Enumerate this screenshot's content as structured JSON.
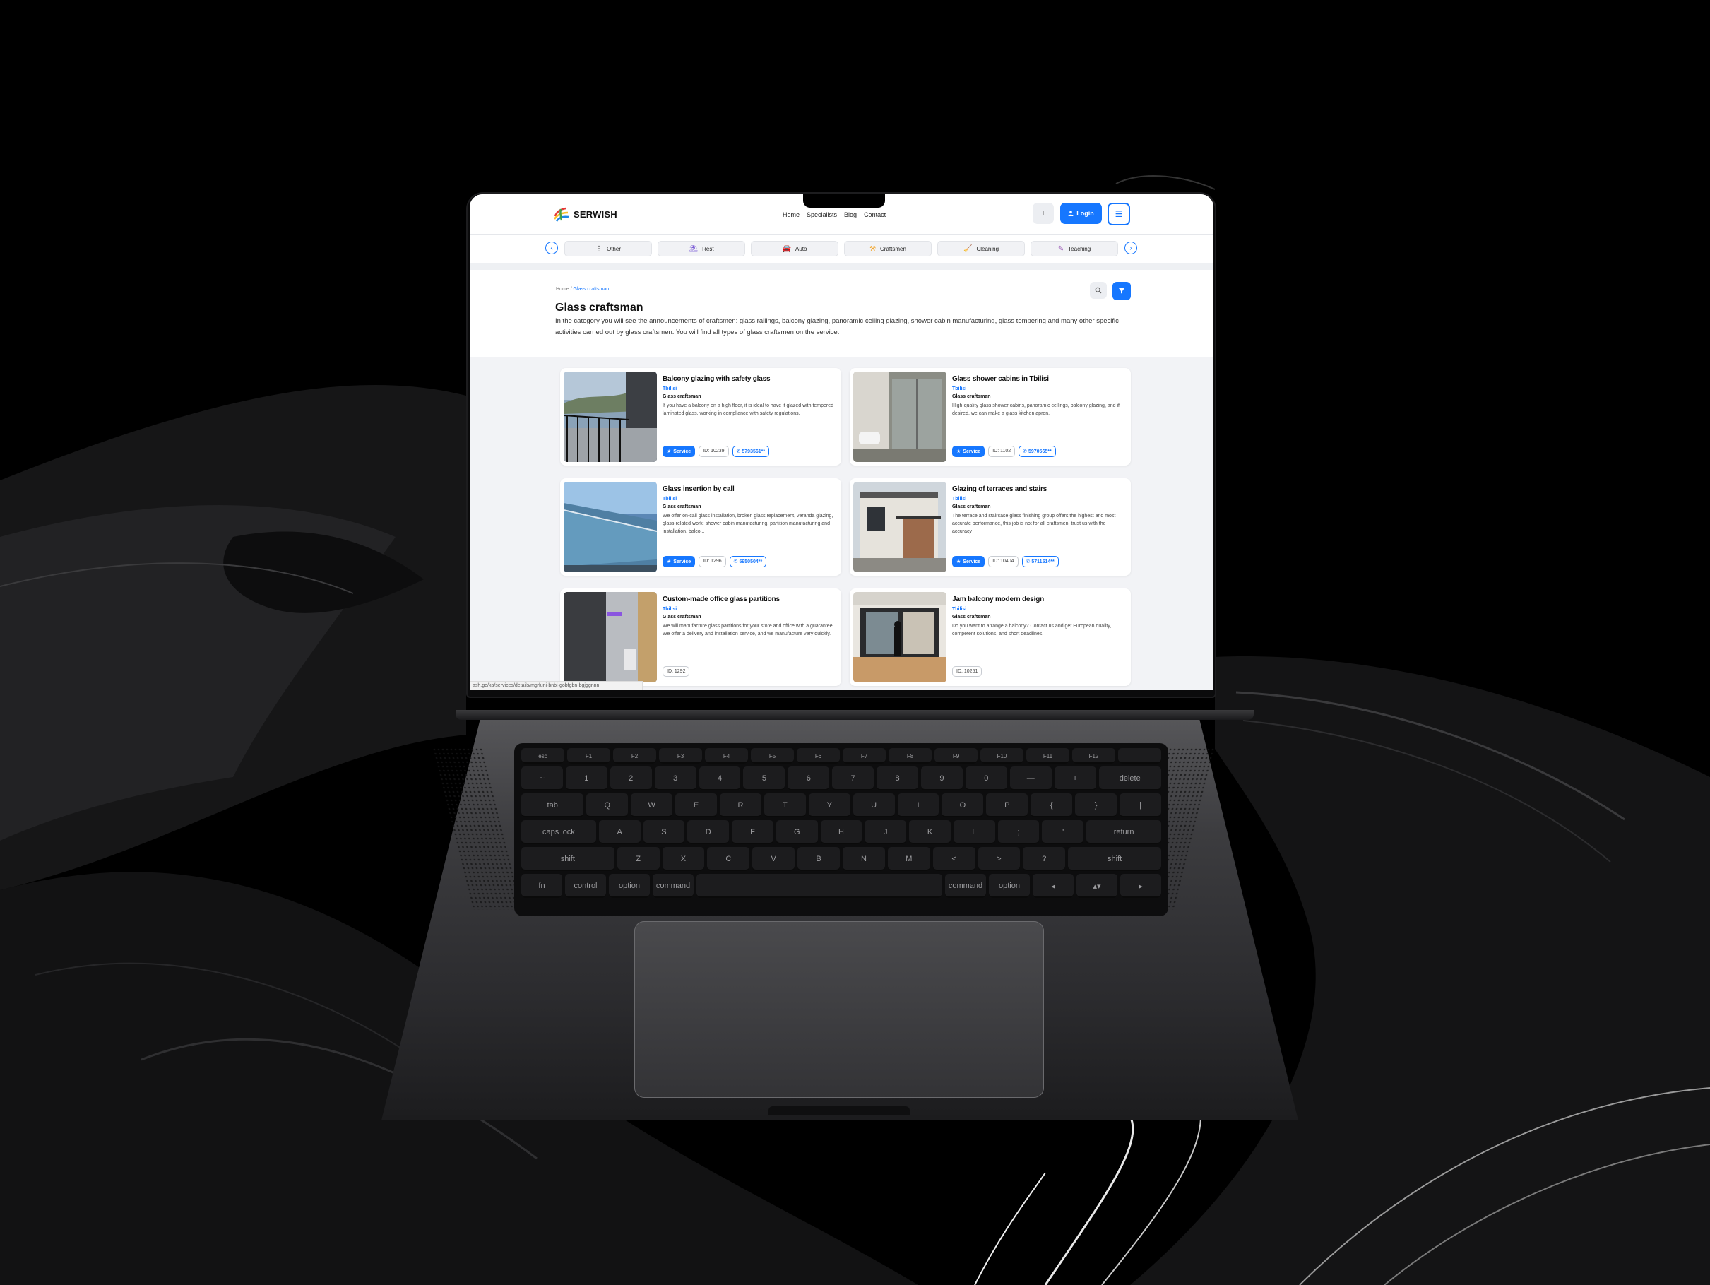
{
  "site": {
    "logo": "SERWISH",
    "nav": [
      "Home",
      "Specialists",
      "Blog",
      "Contact"
    ],
    "plus_label": "+",
    "login_label": "Login",
    "brand_color": "#1677ff"
  },
  "categories": [
    {
      "label": "Other",
      "icon": "dots-icon"
    },
    {
      "label": "Rest",
      "icon": "rest-icon"
    },
    {
      "label": "Auto",
      "icon": "car-icon"
    },
    {
      "label": "Craftsmen",
      "icon": "craftsmen-icon"
    },
    {
      "label": "Cleaning",
      "icon": "cleaning-icon"
    },
    {
      "label": "Teaching",
      "icon": "teaching-icon"
    }
  ],
  "breadcrumb": {
    "home": "Home",
    "separator": "/",
    "current": "Glass craftsman"
  },
  "page": {
    "title": "Glass craftsman",
    "description": "In the category you will see the announcements of craftsmen: glass railings, balcony glazing, panoramic ceiling glazing, shower cabin manufacturing, glass tempering and many other specific activities carried out by glass craftsmen. You will find all types of glass craftsmen on the service."
  },
  "cards": [
    {
      "title": "Balcony glazing with safety glass",
      "city": "Tbilisi",
      "category": "Glass craftsman",
      "description": "If you have a balcony on a high floor, it is ideal to have it glazed with tempered laminated glass, working in compliance with safety regulations.",
      "service_label": "Service",
      "id": "ID: 10239",
      "phone": "5793561**"
    },
    {
      "title": "Glass shower cabins in Tbilisi",
      "city": "Tbilisi",
      "category": "Glass craftsman",
      "description": "High-quality glass shower cabins, panoramic ceilings, balcony glazing, and if desired, we can make a glass kitchen apron.",
      "service_label": "Service",
      "id": "ID: 1102",
      "phone": "5970565**"
    },
    {
      "title": "Glass insertion by call",
      "city": "Tbilisi",
      "category": "Glass craftsman",
      "description": "We offer on-call glass installation, broken glass replacement, veranda glazing, glass-related work: shower cabin manufacturing, partition manufacturing and installation, balco...",
      "service_label": "Service",
      "id": "ID: 1296",
      "phone": "5950504**"
    },
    {
      "title": "Glazing of terraces and stairs",
      "city": "Tbilisi",
      "category": "Glass craftsman",
      "description": "The terrace and staircase glass finishing group offers the highest and most accurate performance, this job is not for all craftsmen, trust us with the accuracy",
      "service_label": "Service",
      "id": "ID: 10404",
      "phone": "5711514**"
    },
    {
      "title": "Custom-made office glass partitions",
      "city": "Tbilisi",
      "category": "Glass craftsman",
      "description": "We will manufacture glass partitions for your store and office with a guarantee. We offer a delivery and installation service, and we manufacture very quickly.",
      "id": "ID: 1292"
    },
    {
      "title": "Jam balcony modern design",
      "city": "Tbilisi",
      "category": "Glass craftsman",
      "description": "Do you want to arrange a balcony? Contact us and get European quality, competent solutions, and short deadlines.",
      "id": "ID: 10251"
    }
  ],
  "status_url": "ash.ge/ka/services/details/mgrluni-bnbi-gobfgbn-bgjggnnn",
  "keyboard": {
    "fn_row": [
      "esc",
      "F1",
      "F2",
      "F3",
      "F4",
      "F5",
      "F6",
      "F7",
      "F8",
      "F9",
      "F10",
      "F11",
      "F12",
      ""
    ],
    "row1": [
      "~",
      "1",
      "2",
      "3",
      "4",
      "5",
      "6",
      "7",
      "8",
      "9",
      "0",
      "—",
      "+",
      "delete"
    ],
    "row2": [
      "tab",
      "Q",
      "W",
      "E",
      "R",
      "T",
      "Y",
      "U",
      "I",
      "O",
      "P",
      "{",
      "}",
      "|"
    ],
    "row3": [
      "caps lock",
      "A",
      "S",
      "D",
      "F",
      "G",
      "H",
      "J",
      "K",
      "L",
      ";",
      "\"",
      "return"
    ],
    "row4": [
      "shift",
      "Z",
      "X",
      "C",
      "V",
      "B",
      "N",
      "M",
      "<",
      ">",
      "?",
      "shift"
    ],
    "row5": [
      "fn",
      "control",
      "option",
      "command",
      "",
      "command",
      "option",
      "◂",
      "▴▾",
      "▸"
    ]
  }
}
